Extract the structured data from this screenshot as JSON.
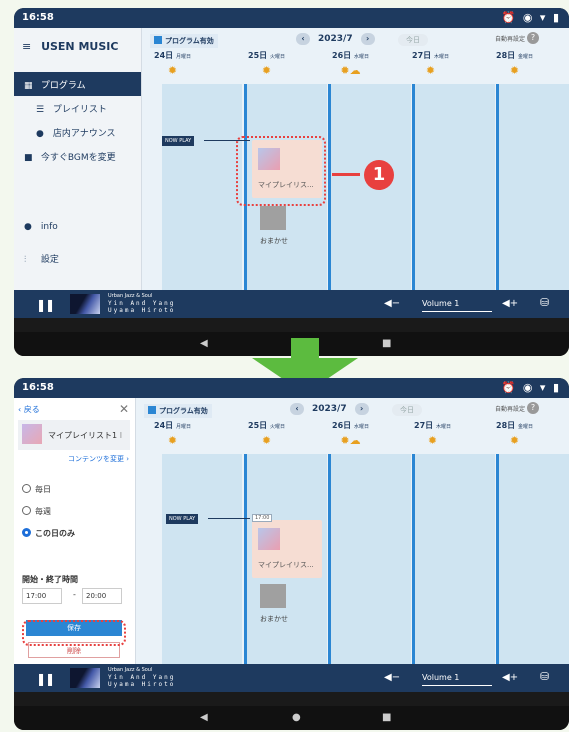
{
  "status": {
    "time": "16:58"
  },
  "app": {
    "brand": "USEN MUSIC"
  },
  "sidebar": {
    "items": [
      {
        "label": "プログラム",
        "active": true
      },
      {
        "label": "プレイリスト"
      },
      {
        "label": "店内アナウンス"
      },
      {
        "label": "今すぐBGMを変更"
      },
      {
        "label": "info"
      },
      {
        "label": "設定"
      }
    ]
  },
  "topbar": {
    "program_toggle": "プログラム有効",
    "month": "2023/7",
    "today": "今日",
    "auto_setting": "自動再設定"
  },
  "days": [
    {
      "label": "24日",
      "weekday": "月曜日"
    },
    {
      "label": "25日",
      "weekday": "火曜日"
    },
    {
      "label": "26日",
      "weekday": "水曜日"
    },
    {
      "label": "27日",
      "weekday": "木曜日"
    },
    {
      "label": "28日",
      "weekday": "金曜日"
    }
  ],
  "calendar": {
    "now_play": "NOW PLAY",
    "playlist_block": "マイプレイリス...",
    "omakase": "おまかせ",
    "block_time": "17:00"
  },
  "player": {
    "channel": "Urban Jazz & Soul",
    "song": "Yin And Yang",
    "artist": "Uyama Hiroto",
    "volume": "Volume 1"
  },
  "callout": {
    "number": "1"
  },
  "panel": {
    "back": "戻る",
    "playlist_name": "マイプレイリスト1",
    "change_content": "コンテンツを変更",
    "options": [
      "毎日",
      "毎週",
      "この日のみ"
    ],
    "selected_option": "この日のみ",
    "time_label": "開始・終了時間",
    "start_time": "17:00",
    "end_time": "20:00",
    "save": "保存",
    "delete": "削除"
  }
}
